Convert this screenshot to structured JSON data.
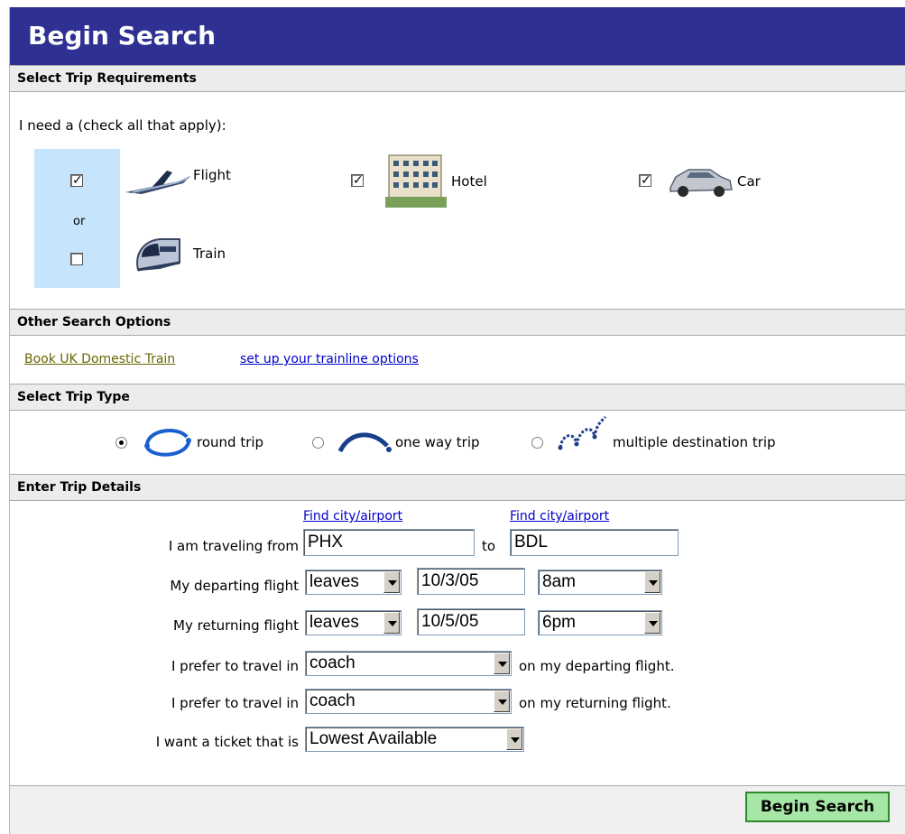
{
  "page": {
    "title": "Begin Search"
  },
  "sections": {
    "requirements": "Select Trip Requirements",
    "other": "Other Search Options",
    "trip_type": "Select Trip Type",
    "details": "Enter Trip Details"
  },
  "requirements": {
    "prompt": "I need a (check all that apply):",
    "or_text": "or",
    "items": [
      {
        "label": "Flight",
        "checked": true,
        "icon": "airplane-icon"
      },
      {
        "label": "Hotel",
        "checked": true,
        "icon": "hotel-building-icon"
      },
      {
        "label": "Car",
        "checked": true,
        "icon": "car-icon"
      },
      {
        "label": "Train",
        "checked": false,
        "icon": "train-icon"
      }
    ],
    "check_mark": "✓"
  },
  "other_options": {
    "link1": "Book UK Domestic Train",
    "link2": "set up your trainline options"
  },
  "trip_type": {
    "options": [
      {
        "label": "round trip",
        "selected": true
      },
      {
        "label": "one way trip",
        "selected": false
      },
      {
        "label": "multiple destination trip",
        "selected": false
      }
    ]
  },
  "details": {
    "find_link": "Find city/airport",
    "from_label": "I am traveling from",
    "from_value": "PHX",
    "to_label": "to",
    "to_value": "BDL",
    "depart_label": "My departing flight",
    "depart_when": "leaves",
    "depart_date": "10/3/05",
    "depart_time": "8am",
    "return_label": "My returning flight",
    "return_when": "leaves",
    "return_date": "10/5/05",
    "return_time": "6pm",
    "class_label": "I prefer to travel in",
    "depart_class": "coach",
    "depart_class_suffix": "on my departing flight.",
    "return_class": "coach",
    "return_class_suffix": "on my returning flight.",
    "ticket_label": "I want a ticket that is",
    "ticket_value": "Lowest Available"
  },
  "actions": {
    "search_label": "Begin Search"
  },
  "colors": {
    "title_bg": "#2e3192",
    "highlight_bg": "#c6e4fb",
    "button_bg": "#a6e6a6"
  }
}
